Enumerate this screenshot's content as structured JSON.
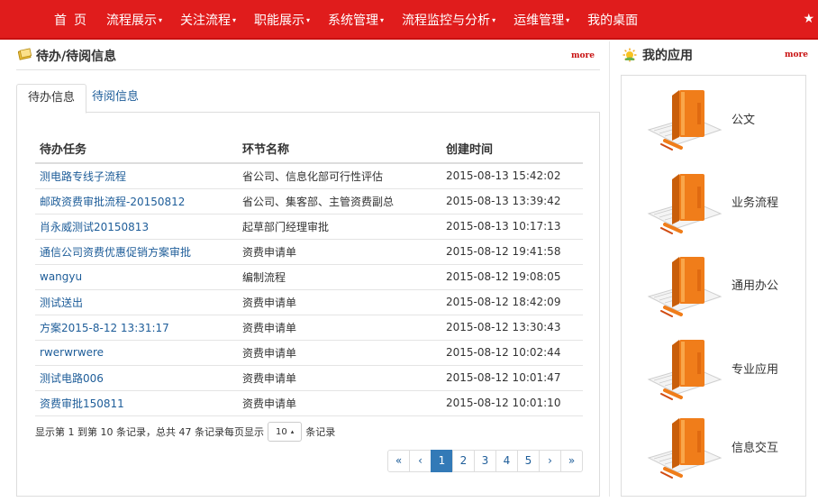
{
  "nav": {
    "items": [
      {
        "label": "首页",
        "dropdown": false
      },
      {
        "label": "流程展示",
        "dropdown": true
      },
      {
        "label": "关注流程",
        "dropdown": true
      },
      {
        "label": "职能展示",
        "dropdown": true
      },
      {
        "label": "系统管理",
        "dropdown": true
      },
      {
        "label": "流程监控与分析",
        "dropdown": true
      },
      {
        "label": "运维管理",
        "dropdown": true
      },
      {
        "label": "我的桌面",
        "dropdown": false
      }
    ],
    "caret": "▾",
    "star": "★"
  },
  "todo_panel": {
    "title": "待办/待阅信息",
    "more": "more",
    "tabs": [
      {
        "label": "待办信息",
        "active": true
      },
      {
        "label": "待阅信息",
        "active": false
      }
    ],
    "columns": [
      "待办任务",
      "环节名称",
      "创建时间"
    ],
    "rows": [
      {
        "task": "测电路专线子流程",
        "node": "省公司、信息化部可行性评估",
        "time": "2015-08-13 15:42:02"
      },
      {
        "task": "邮政资费审批流程-20150812",
        "node": "省公司、集客部、主管资费副总",
        "time": "2015-08-13 13:39:42"
      },
      {
        "task": "肖永威测试20150813",
        "node": "起草部门经理审批",
        "time": "2015-08-13 10:17:13"
      },
      {
        "task": "通信公司资费优惠促销方案审批",
        "node": "资费申请单",
        "time": "2015-08-12 19:41:58"
      },
      {
        "task": "wangyu",
        "node": "编制流程",
        "time": "2015-08-12 19:08:05"
      },
      {
        "task": "测试送出",
        "node": "资费申请单",
        "time": "2015-08-12 18:42:09"
      },
      {
        "task": "方案2015-8-12 13:31:17",
        "node": "资费申请单",
        "time": "2015-08-12 13:30:43"
      },
      {
        "task": "rwerwrwere",
        "node": "资费申请单",
        "time": "2015-08-12 10:02:44"
      },
      {
        "task": "测试电路006",
        "node": "资费申请单",
        "time": "2015-08-12 10:01:47"
      },
      {
        "task": "资费审批150811",
        "node": "资费申请单",
        "time": "2015-08-12 10:01:10"
      }
    ],
    "info_before": "显示第 1 到第 10 条记录，总共 47 条记录每页显示",
    "page_size": "10",
    "page_size_arrow": "▴",
    "info_after": "条记录",
    "pagination": [
      "«",
      "‹",
      "1",
      "2",
      "3",
      "4",
      "5",
      "›",
      "»"
    ],
    "active_page": "1"
  },
  "apps_panel": {
    "title": "我的应用",
    "more": "more",
    "apps": [
      "公文",
      "业务流程",
      "通用办公",
      "专业应用",
      "信息交互"
    ]
  },
  "colors": {
    "nav_bg": "#e01c1c",
    "link": "#1e5d99",
    "active_page": "#337ab7",
    "book_orange": "#f07d1a"
  },
  "icons": {
    "todo": "notebook-icon",
    "apps": "sun-icon",
    "app": "book-icon",
    "star": "star-icon"
  }
}
